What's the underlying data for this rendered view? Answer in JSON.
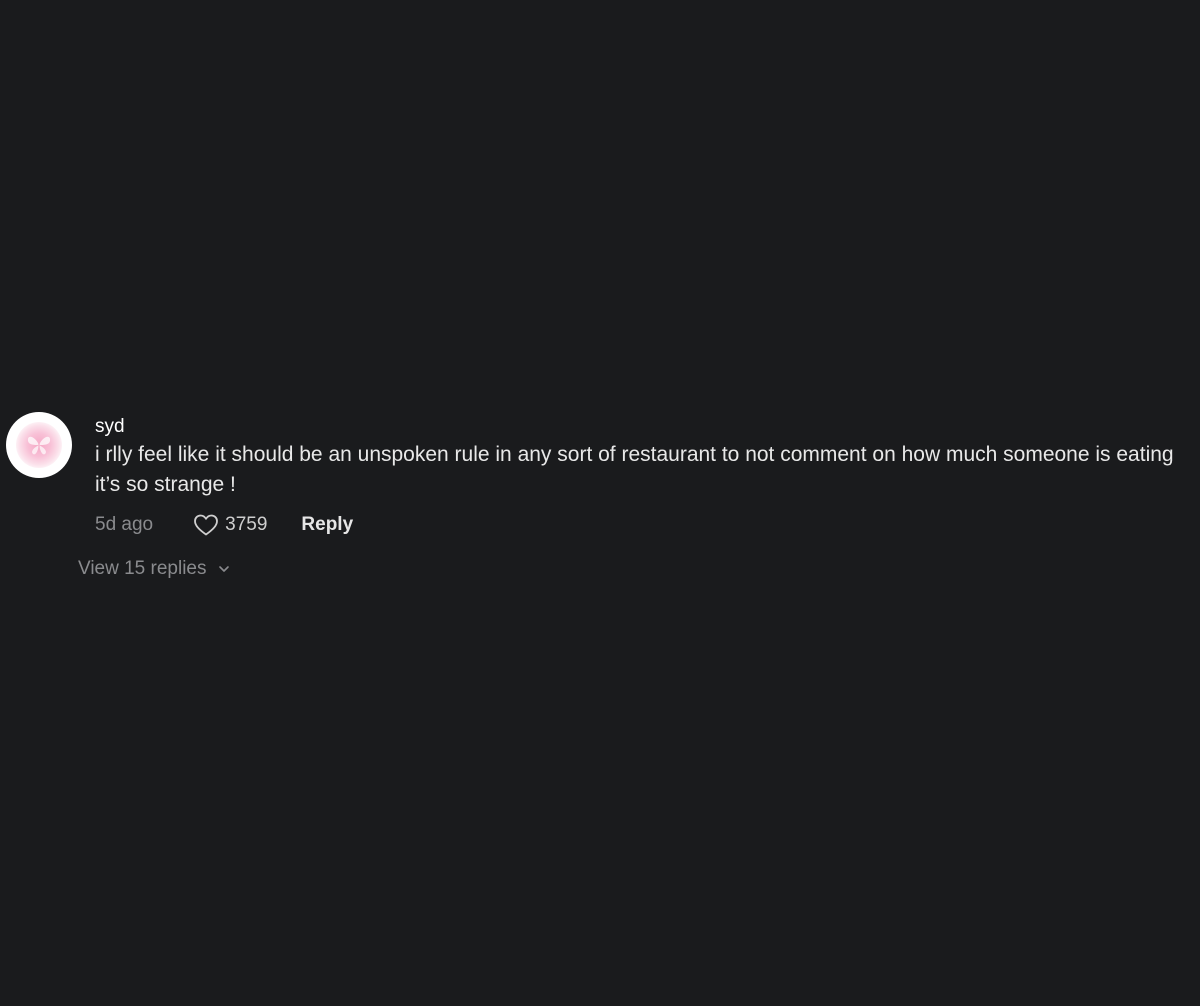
{
  "comment": {
    "username": "syd",
    "text": "i rlly feel like it should be an unspoken rule in any sort of restaurant to not comment on how much someone is eating it’s so strange !",
    "timestamp": "5d ago",
    "like_count": "3759",
    "reply_label": "Reply",
    "avatar_icon": "pink-butterfly-icon"
  },
  "replies": {
    "view_label": "View 15 replies",
    "icon": "chevron-down-icon"
  },
  "colors": {
    "background": "#1a1b1d",
    "primary_text": "#e8e8e8",
    "secondary_text": "#8a8b8e",
    "avatar_accent": "#f5a9c6"
  }
}
